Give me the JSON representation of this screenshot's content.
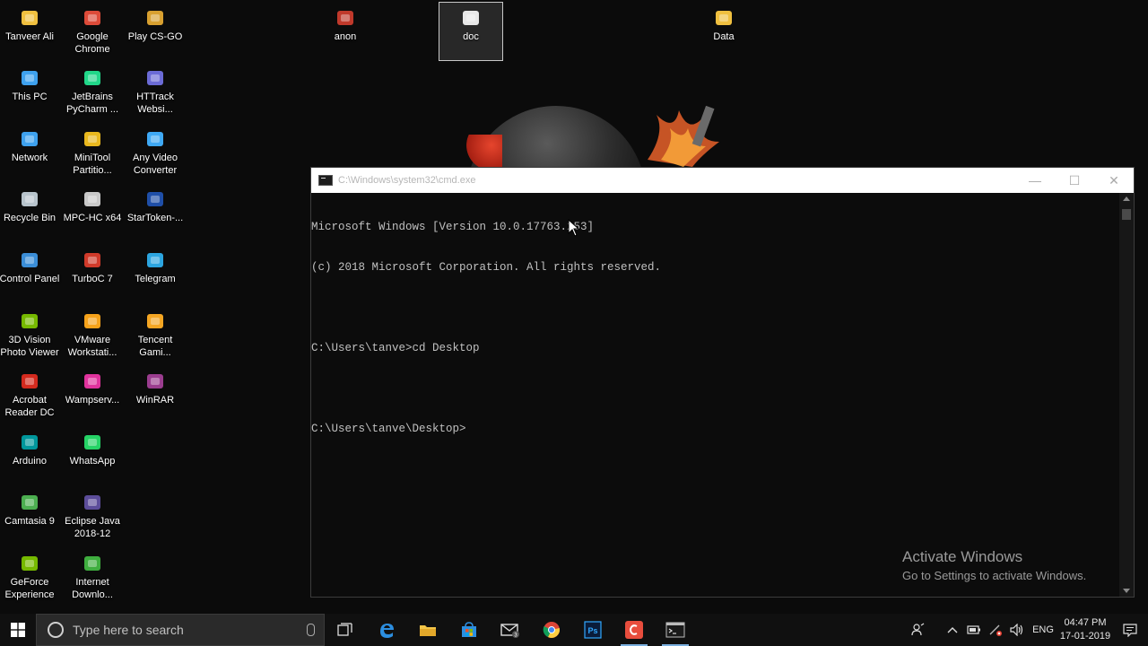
{
  "desktop": {
    "icons": [
      {
        "label": "Tanveer Ali",
        "icon": "folder-user-icon",
        "color": "#f0c040"
      },
      {
        "label": "This PC",
        "icon": "computer-icon",
        "color": "#3ea1ee"
      },
      {
        "label": "Network",
        "icon": "network-icon",
        "color": "#3ea1ee"
      },
      {
        "label": "Recycle Bin",
        "icon": "recycle-bin-icon",
        "color": "#b8c4cc"
      },
      {
        "label": "Control Panel",
        "icon": "control-panel-icon",
        "color": "#3b8ed8"
      },
      {
        "label": "3D Vision Photo Viewer",
        "icon": "photo-viewer-icon",
        "color": "#76b900"
      },
      {
        "label": "Acrobat Reader DC",
        "icon": "acrobat-icon",
        "color": "#d42a1e"
      },
      {
        "label": "Arduino",
        "icon": "arduino-icon",
        "color": "#00979c"
      },
      {
        "label": "Camtasia 9",
        "icon": "camtasia-icon",
        "color": "#4caf50"
      },
      {
        "label": "GeForce Experience",
        "icon": "geforce-icon",
        "color": "#76b900"
      },
      {
        "label": "Google Chrome",
        "icon": "chrome-icon",
        "color": "#dd4b39"
      },
      {
        "label": "JetBrains PyCharm ...",
        "icon": "pycharm-icon",
        "color": "#21d789"
      },
      {
        "label": "MiniTool Partitio...",
        "icon": "minitool-icon",
        "color": "#e9b81e"
      },
      {
        "label": "MPC-HC x64",
        "icon": "mpc-hc-icon",
        "color": "#c8c8c8"
      },
      {
        "label": "TurboC 7",
        "icon": "turboc-icon",
        "color": "#d03a2a"
      },
      {
        "label": "VMware Workstati...",
        "icon": "vmware-icon",
        "color": "#f6a21a"
      },
      {
        "label": "Wampserv...",
        "icon": "wampserver-icon",
        "color": "#e0339d"
      },
      {
        "label": "WhatsApp",
        "icon": "whatsapp-icon",
        "color": "#25d366"
      },
      {
        "label": "Eclipse Java 2018-12",
        "icon": "eclipse-icon",
        "color": "#5c4d9a"
      },
      {
        "label": "Internet Downlo...",
        "icon": "idm-icon",
        "color": "#3fae3f"
      },
      {
        "label": "Play CS-GO",
        "icon": "csgo-icon",
        "color": "#d8a030"
      },
      {
        "label": "HTTrack Websi...",
        "icon": "httrack-icon",
        "color": "#6b6bd6"
      },
      {
        "label": "Any Video Converter",
        "icon": "video-converter-icon",
        "color": "#3fa9f5"
      },
      {
        "label": "StarToken-...",
        "icon": "startoken-icon",
        "color": "#1f4fa8"
      },
      {
        "label": "Telegram",
        "icon": "telegram-icon",
        "color": "#2ca5e0"
      },
      {
        "label": "Tencent Gami...",
        "icon": "tencent-icon",
        "color": "#f5a623"
      },
      {
        "label": "WinRAR",
        "icon": "winrar-icon",
        "color": "#9b3d8f"
      },
      {
        "label": "anon",
        "icon": "anon-icon",
        "color": "#c0392b"
      },
      {
        "label": "doc",
        "icon": "document-icon",
        "color": "#e8e8e8"
      },
      {
        "label": "Data",
        "icon": "folder-icon",
        "color": "#f0c040"
      }
    ]
  },
  "cmd": {
    "title": "C:\\Windows\\system32\\cmd.exe",
    "lines": [
      "Microsoft Windows [Version 10.0.17763.253]",
      "(c) 2018 Microsoft Corporation. All rights reserved.",
      "",
      "C:\\Users\\tanve>cd Desktop",
      "",
      "C:\\Users\\tanve\\Desktop>"
    ],
    "minimize": "—",
    "maximize": "☐",
    "close": "✕"
  },
  "watermark": {
    "title": "Activate Windows",
    "subtitle": "Go to Settings to activate Windows."
  },
  "taskbar": {
    "search_placeholder": "Type here to search",
    "language": "ENG",
    "time": "04:47 PM",
    "date": "17-01-2019",
    "pinned": [
      {
        "name": "task-view-icon"
      },
      {
        "name": "edge-icon"
      },
      {
        "name": "file-explorer-icon"
      },
      {
        "name": "store-icon"
      },
      {
        "name": "mail-icon"
      },
      {
        "name": "chrome-icon"
      },
      {
        "name": "photoshop-icon"
      },
      {
        "name": "camtasia-icon"
      },
      {
        "name": "cmd-icon"
      }
    ]
  }
}
